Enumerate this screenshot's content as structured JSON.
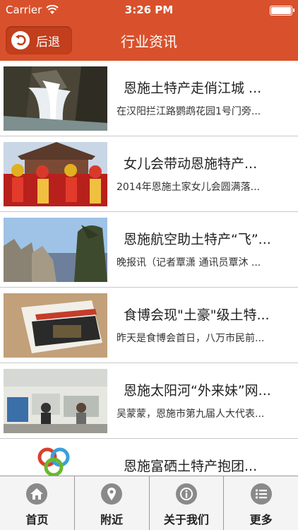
{
  "status_bar": {
    "carrier": "Carrier",
    "time": "3:26 PM"
  },
  "nav": {
    "back_label": "后退",
    "title": "行业资讯"
  },
  "news": [
    {
      "title": "恩施土特产走俏江城 ...",
      "summary": "在汉阳拦江路鹦鹉花园1号门旁..."
    },
    {
      "title": "女儿会带动恩施特产...",
      "summary": "2014年恩施土家女儿会圆满落..."
    },
    {
      "title": "恩施航空助土特产“飞”...",
      "summary": "晚报讯（记者覃潇 通讯员覃沐 ..."
    },
    {
      "title": "食博会现\"土豪\"级土特...",
      "summary": "昨天是食博会首日，八万市民前..."
    },
    {
      "title": "恩施太阳河“外来妹”网...",
      "summary": "吴蒙蒙，恩施市第九届人大代表..."
    },
    {
      "title": "恩施富硒土特产抱团...",
      "summary": ""
    }
  ],
  "tabs": [
    {
      "label": "首页",
      "icon": "home-icon"
    },
    {
      "label": "附近",
      "icon": "location-pin-icon"
    },
    {
      "label": "关于我们",
      "icon": "info-icon"
    },
    {
      "label": "更多",
      "icon": "list-icon"
    }
  ],
  "colors": {
    "accent": "#d9512c",
    "back_button": "#c23e1c",
    "tab_icon": "#8a8a8a"
  }
}
